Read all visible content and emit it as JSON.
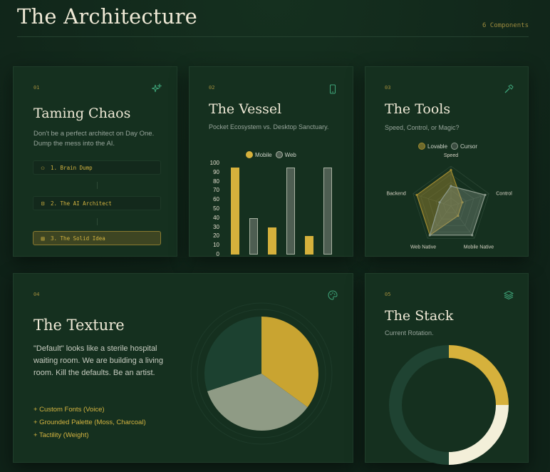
{
  "page": {
    "title": "The Architecture",
    "count": "6 Components"
  },
  "cards": {
    "chaos": {
      "num": "01",
      "title": "Taming Chaos",
      "sub": "Don't be a perfect architect on Day One. Dump the mess into the AI.",
      "steps": [
        {
          "label": "1. Brain Dump",
          "icon": "brain-icon"
        },
        {
          "label": "2. The AI Architect",
          "icon": "robot-icon"
        },
        {
          "label": "3. The Solid Idea",
          "icon": "document-icon"
        }
      ]
    },
    "vessel": {
      "num": "02",
      "title": "The Vessel",
      "sub": "Pocket Ecosystem vs. Desktop Sanctuary."
    },
    "tools": {
      "num": "03",
      "title": "The Tools",
      "sub": "Speed, Control, or Magic?"
    },
    "texture": {
      "num": "04",
      "title": "The Texture",
      "sub": "\"Default\" looks like a sterile hospital waiting room. We are building a living room. Kill the defaults. Be an artist.",
      "list": [
        "+ Custom Fonts (Voice)",
        "+ Grounded Palette (Moss, Charcoal)",
        "+ Tactility (Weight)"
      ]
    },
    "stack": {
      "num": "05",
      "title": "The Stack",
      "sub": "Current Rotation."
    }
  },
  "chart_data": [
    {
      "type": "bar",
      "categories": [
        "",
        "",
        ""
      ],
      "series": [
        {
          "name": "Mobile",
          "values": [
            95,
            30,
            20
          ],
          "color": "#d6b13c"
        },
        {
          "name": "Web",
          "values": [
            40,
            95,
            95
          ],
          "color": "#4e5e52"
        }
      ],
      "yticks": [
        "0",
        "10",
        "20",
        "30",
        "40",
        "50",
        "60",
        "70",
        "80",
        "90",
        "100"
      ],
      "ylim": [
        0,
        100
      ],
      "legend": "top"
    },
    {
      "type": "radar",
      "axes": [
        "Speed",
        "Control",
        "Mobile Native",
        "Web Native",
        "Backend"
      ],
      "series": [
        {
          "name": "Lovable",
          "values": [
            90,
            30,
            30,
            90,
            90
          ],
          "color": "#a08a30"
        },
        {
          "name": "Cursor",
          "values": [
            50,
            90,
            90,
            90,
            30
          ],
          "color": "#8c9a8c"
        }
      ],
      "max": 100,
      "legend": "top"
    },
    {
      "type": "pie",
      "values": [
        35,
        35,
        30
      ],
      "colors": [
        "#c9a431",
        "#8f9b85",
        "#1c4130"
      ]
    },
    {
      "type": "pie",
      "values": [
        25,
        25,
        50
      ],
      "colors": [
        "#d6b13c",
        "#f3efd9",
        "#1f4332"
      ]
    }
  ],
  "colors": {
    "accent": "#d6b13c",
    "background": "#10241a",
    "card": "#15301f"
  }
}
